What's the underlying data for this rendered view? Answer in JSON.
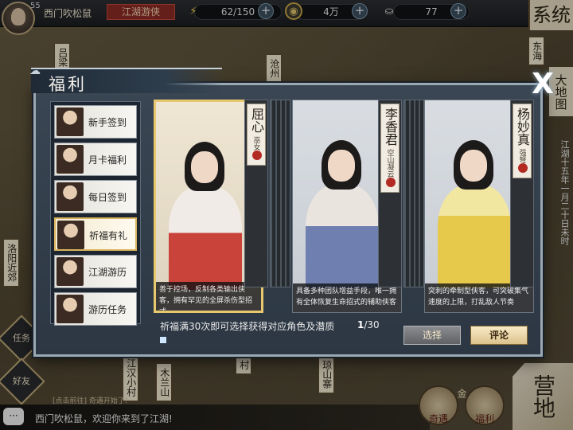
{
  "player": {
    "level": "55",
    "name": "西门吹松鼠",
    "title": "江湖游侠"
  },
  "resources": {
    "stamina": "62/150",
    "coins": "4万",
    "silver": "77"
  },
  "side_buttons": {
    "system": "系统",
    "world_map": "大地图",
    "date": "江湖十五年一月二十日未时",
    "task": "任务",
    "friends": "好友",
    "camp": "营地"
  },
  "map_places": [
    "吕梁",
    "沧州",
    "东海",
    "洛阳近郊",
    "江汉小村",
    "木兰山",
    "村",
    "琼山寨"
  ],
  "chat": {
    "hint": "[点击前往] 奇遇开始了!",
    "message": "西门吹松鼠，欢迎你来到了江湖!"
  },
  "bottom_buttons": {
    "gold": "金",
    "adventure": "奇遇",
    "welfare": "福利"
  },
  "modal": {
    "title": "福利",
    "close_label": "X",
    "sidebar": [
      {
        "label": "新手签到",
        "active": false
      },
      {
        "label": "月卡福利",
        "active": false
      },
      {
        "label": "每日签到",
        "active": false
      },
      {
        "label": "祈福有礼",
        "active": true
      },
      {
        "label": "江湖游历",
        "active": false
      },
      {
        "label": "游历任务",
        "active": false
      }
    ],
    "cards": [
      {
        "name": "屈心",
        "subtitle": "巫女",
        "description": "善于控场，反制各类输出侠客，拥有罕见的全屏杀伤型招式",
        "selected": true,
        "outfit_color": "#c9433a"
      },
      {
        "name": "李香君",
        "subtitle": "空山凝云",
        "description": "具备多种团队增益手段，唯一拥有全体恢复生命招式的辅助侠客",
        "selected": false,
        "outfit_color": "#6e7fb0"
      },
      {
        "name": "杨妙真",
        "subtitle": "强弩",
        "description": "突刺的牵制型侠客，可突破集气速度的上限，打乱敌人节奏",
        "selected": false,
        "outfit_color": "#e6c84a"
      }
    ],
    "pray_text": "祈福满30次即可选择获得对应角色及潜质",
    "progress": {
      "current": "1",
      "total": "/30"
    },
    "select_button": "选择",
    "comment_button": "评论"
  },
  "colors": {
    "accent_red": "#8c2b24",
    "selected_gold": "#e8c86e",
    "modal_bg": "#3a4653"
  }
}
